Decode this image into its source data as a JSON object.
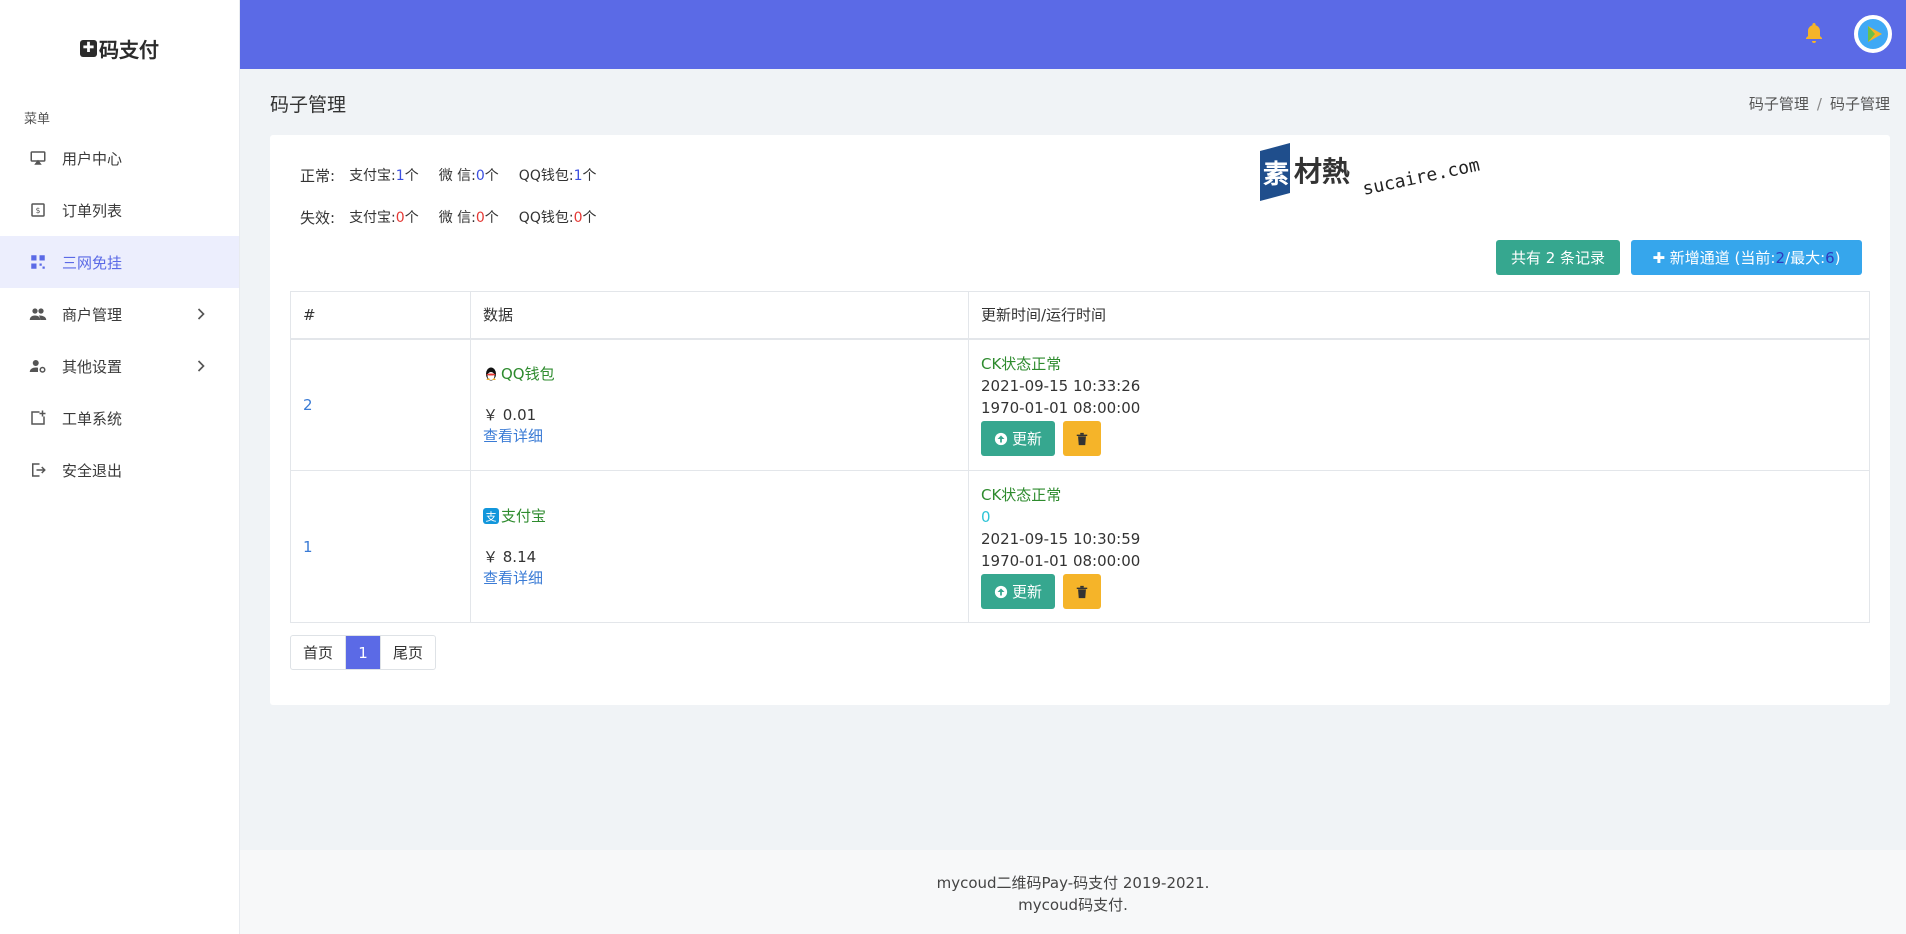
{
  "brand": {
    "mark": "✚",
    "name": "码支付"
  },
  "sidebar": {
    "header": "菜单",
    "items": [
      {
        "label": "用户中心"
      },
      {
        "label": "订单列表"
      },
      {
        "label": "三网免挂"
      },
      {
        "label": "商户管理"
      },
      {
        "label": "其他设置"
      },
      {
        "label": "工单系统"
      },
      {
        "label": "安全退出"
      }
    ]
  },
  "page": {
    "title": "码子管理",
    "breadcrumb": [
      "码子管理",
      "码子管理"
    ]
  },
  "status": {
    "normal": {
      "label": "正常:",
      "alipay": "1",
      "wechat": "0",
      "qq": "1"
    },
    "invalid": {
      "label": "失效:",
      "alipay": "0",
      "wechat": "0",
      "qq": "0"
    },
    "alipay_label": "支付宝:",
    "wechat_label": "微 信:",
    "qq_label": "QQ钱包:",
    "unit": "个"
  },
  "watermark": {
    "cn": "素材熱",
    "en": "sucaire.com"
  },
  "actions": {
    "total": "共有 2 条记录",
    "add_prefix": "✚ 新增通道 (当前: ",
    "add_current": "2",
    "add_mid": "/最大: ",
    "add_max": "6",
    "add_suffix": ")"
  },
  "table": {
    "headers": [
      "#",
      "数据",
      "更新时间/运行时间"
    ],
    "rows": [
      {
        "id": "2",
        "channel": "QQ钱包",
        "amount": "￥ 0.01",
        "detail": "查看详细",
        "status": "CK状态正常",
        "extra": "",
        "updated": "2021-09-15 10:33:26",
        "runtime": "1970-01-01 08:00:00",
        "update_btn": "更新"
      },
      {
        "id": "1",
        "channel": "支付宝",
        "amount": "￥ 8.14",
        "detail": "查看详细",
        "status": "CK状态正常",
        "extra": "0",
        "updated": "2021-09-15 10:30:59",
        "runtime": "1970-01-01 08:00:00",
        "update_btn": "更新"
      }
    ]
  },
  "pager": {
    "first": "首页",
    "current": "1",
    "last": "尾页"
  },
  "footer": {
    "line1": "mycoud二维码Pay-码支付 2019-2021.",
    "line2": "mycoud码支付."
  },
  "colors": {
    "primary": "#5b6ae6",
    "success": "#36a78f",
    "info": "#36a6ec",
    "warning": "#f5b429"
  }
}
